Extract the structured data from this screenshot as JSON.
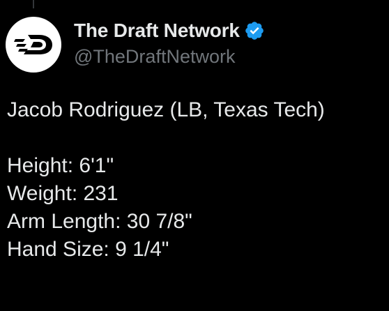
{
  "author": {
    "display_name": "The Draft Network",
    "handle": "@TheDraftNetwork",
    "verified": true,
    "avatar_icon": "the-draft-network-logo",
    "verified_icon": "verified-badge-icon"
  },
  "tweet": {
    "title_line": "Jacob Rodriguez (LB, Texas Tech)",
    "stats": [
      "Height: 6'1\"",
      "Weight: 231",
      "Arm Length: 30 7/8\"",
      "Hand Size: 9 1/4\""
    ]
  },
  "colors": {
    "background": "#000000",
    "primary_text": "#e7e9ea",
    "secondary_text": "#71767b",
    "verified_blue": "#1d9bf0",
    "avatar_bg": "#ffffff",
    "logo": "#000000"
  }
}
